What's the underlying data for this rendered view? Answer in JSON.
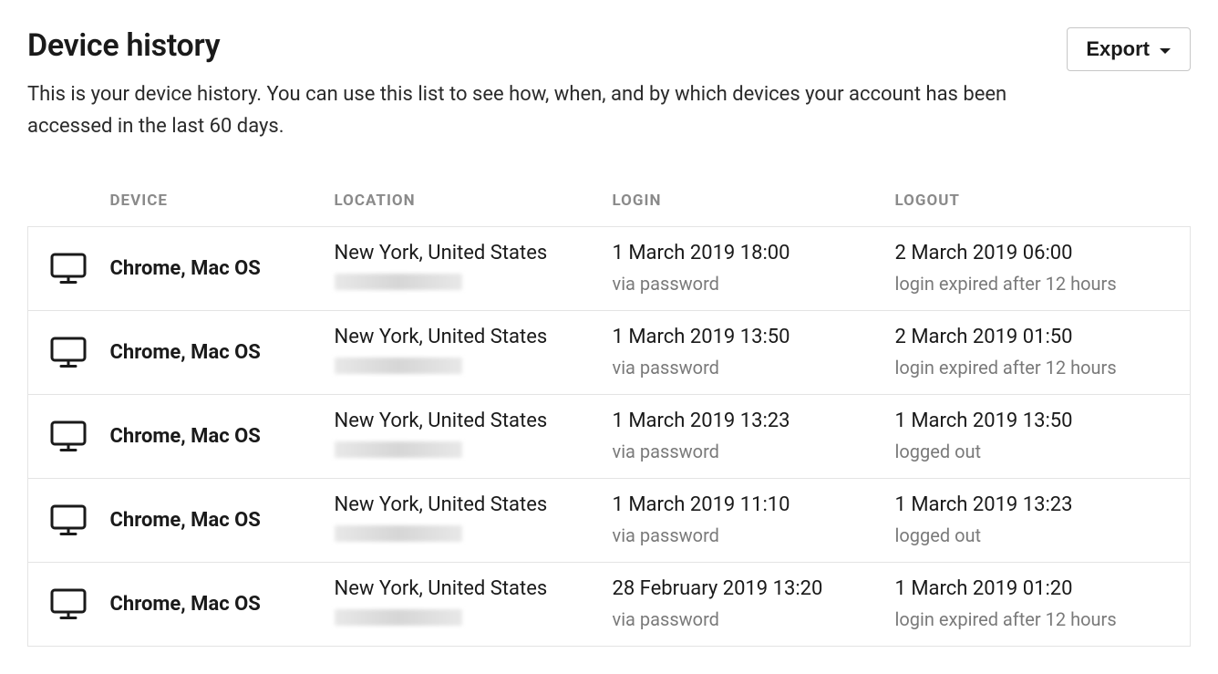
{
  "header": {
    "title": "Device history",
    "export_label": "Export"
  },
  "description": "This is your device history. You can use this list to see how, when, and by which devices your account has been accessed in the last 60 days.",
  "columns": {
    "device": "DEVICE",
    "location": "LOCATION",
    "login": "LOGIN",
    "logout": "LOGOUT"
  },
  "rows": [
    {
      "device": "Chrome, Mac OS",
      "location": "New York, United States",
      "login_time": "1 March 2019 18:00",
      "login_method": "via password",
      "logout_time": "2 March 2019 06:00",
      "logout_detail": "login expired after 12 hours"
    },
    {
      "device": "Chrome, Mac OS",
      "location": "New York, United States",
      "login_time": "1 March 2019 13:50",
      "login_method": "via password",
      "logout_time": "2 March 2019 01:50",
      "logout_detail": "login expired after 12 hours"
    },
    {
      "device": "Chrome, Mac OS",
      "location": "New York, United States",
      "login_time": "1 March 2019 13:23",
      "login_method": "via password",
      "logout_time": "1 March 2019 13:50",
      "logout_detail": "logged out"
    },
    {
      "device": "Chrome, Mac OS",
      "location": "New York, United States",
      "login_time": "1 March 2019 11:10",
      "login_method": "via password",
      "logout_time": "1 March 2019 13:23",
      "logout_detail": "logged out"
    },
    {
      "device": "Chrome, Mac OS",
      "location": "New York, United States",
      "login_time": "28 February 2019 13:20",
      "login_method": "via password",
      "logout_time": "1 March 2019 01:20",
      "logout_detail": "login expired after 12 hours"
    }
  ]
}
